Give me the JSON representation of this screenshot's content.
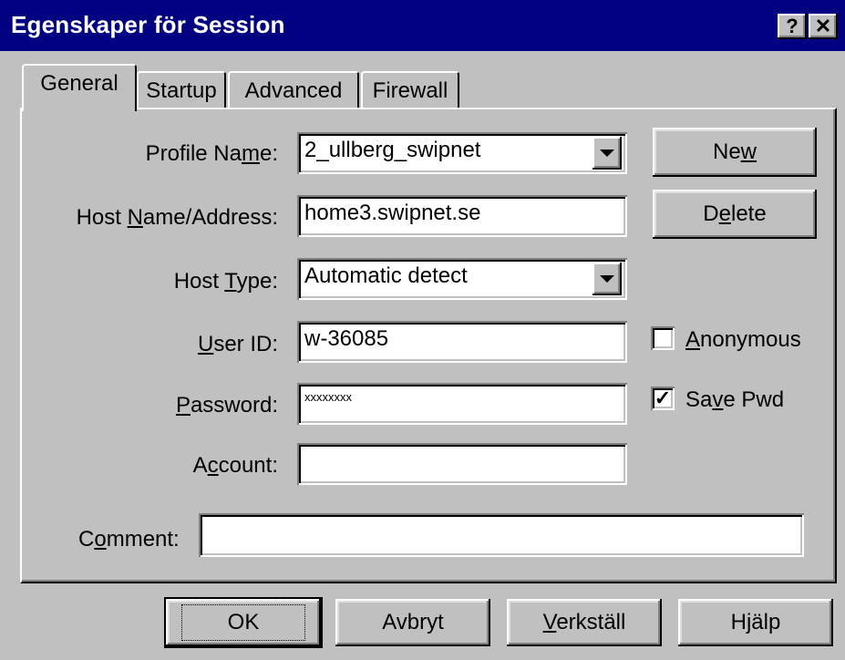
{
  "window": {
    "title": "Egenskaper för Session",
    "help_button": "?",
    "close_button": "✕"
  },
  "tabs": [
    {
      "label": "General",
      "active": true
    },
    {
      "label": "Startup",
      "active": false
    },
    {
      "label": "Advanced",
      "active": false
    },
    {
      "label": "Firewall",
      "active": false
    }
  ],
  "form": {
    "profile_name": {
      "label_pre": "Profile Na",
      "label_u": "m",
      "label_post": "e:",
      "value": "2_ullberg_swipnet"
    },
    "host_name": {
      "label_pre": "Host ",
      "label_u": "N",
      "label_post": "ame/Address:",
      "value": "home3.swipnet.se"
    },
    "host_type": {
      "label_pre": "Host ",
      "label_u": "T",
      "label_post": "ype:",
      "value": "Automatic detect"
    },
    "user_id": {
      "label_pre": "",
      "label_u": "U",
      "label_post": "ser ID:",
      "value": "w-36085"
    },
    "password": {
      "label_pre": "",
      "label_u": "P",
      "label_post": "assword:",
      "value": "xxxxxxxx"
    },
    "account": {
      "label_pre": "A",
      "label_u": "c",
      "label_post": "count:",
      "value": ""
    },
    "comment": {
      "label_pre": "C",
      "label_u": "o",
      "label_post": "mment:",
      "value": ""
    }
  },
  "side_buttons": {
    "new": {
      "pre": "Ne",
      "u": "w",
      "post": ""
    },
    "delete": {
      "pre": "D",
      "u": "e",
      "post": "lete"
    }
  },
  "checkboxes": {
    "anonymous": {
      "pre": "",
      "u": "A",
      "post": "nonymous",
      "checked": false,
      "mark": ""
    },
    "save_pwd": {
      "pre": "Sa",
      "u": "v",
      "post": "e Pwd",
      "checked": true,
      "mark": "✓"
    }
  },
  "footer": {
    "ok": "OK",
    "cancel": "Avbryt",
    "apply": {
      "pre": "",
      "u": "V",
      "post": "erkställ"
    },
    "help": "Hjälp"
  }
}
